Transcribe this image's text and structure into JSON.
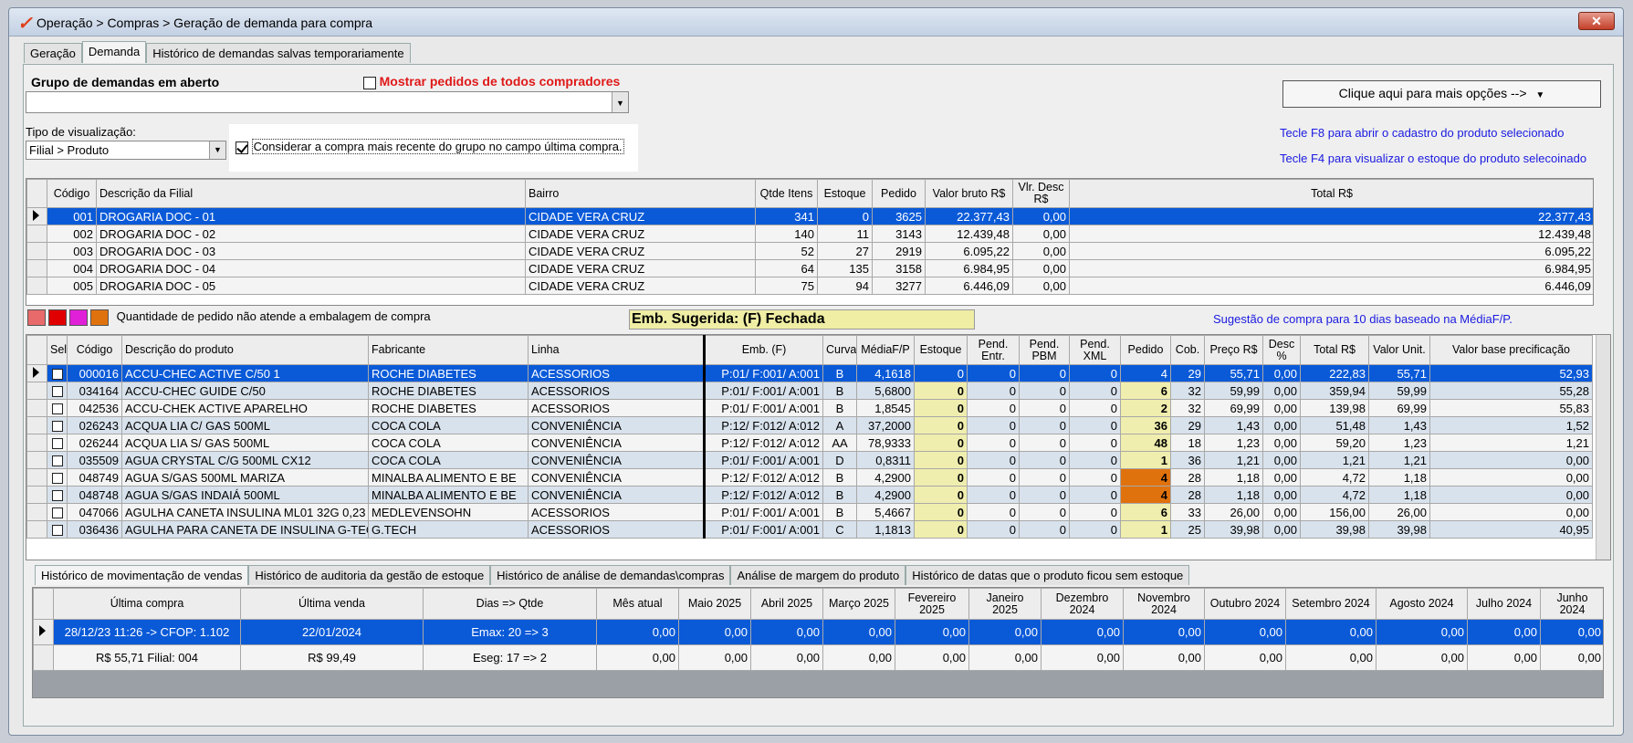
{
  "window": {
    "title": "Operação > Compras > Geração de demanda para compra",
    "close_label": "✕"
  },
  "tabs": [
    {
      "label": "Geração"
    },
    {
      "label": "Demanda"
    },
    {
      "label": "Histórico de demandas salvas temporariamente"
    }
  ],
  "top": {
    "group_label": "Grupo de demandas em aberto",
    "show_all_label": "Mostrar pedidos de todos compradores",
    "group_value": "",
    "view_type_label": "Tipo de visualização:",
    "view_type_value": "Filial > Produto",
    "consider_label": "Considerar a compra mais recente do grupo no campo última compra.",
    "options_button": "Clique aqui para mais opções -->",
    "hint_f8": "Tecle F8 para abrir o cadastro do produto selecionado",
    "hint_f4": "Tecle F4 para visualizar o estoque do produto selecoinado"
  },
  "branch_grid": {
    "headers": [
      "Código",
      "Descrição da Filial",
      "Bairro",
      "Qtde Itens",
      "Estoque",
      "Pedido",
      "Valor bruto R$",
      "Vlr. Desc R$",
      "Total R$"
    ],
    "rows": [
      [
        "001",
        "DROGARIA DOC - 01",
        "CIDADE VERA CRUZ",
        "341",
        "0",
        "3625",
        "22.377,43",
        "0,00",
        "22.377,43"
      ],
      [
        "002",
        "DROGARIA DOC - 02",
        "CIDADE VERA CRUZ",
        "140",
        "11",
        "3143",
        "12.439,48",
        "0,00",
        "12.439,48"
      ],
      [
        "003",
        "DROGARIA DOC - 03",
        "CIDADE VERA CRUZ",
        "52",
        "27",
        "2919",
        "6.095,22",
        "0,00",
        "6.095,22"
      ],
      [
        "004",
        "DROGARIA DOC - 04",
        "CIDADE VERA CRUZ",
        "64",
        "135",
        "3158",
        "6.984,95",
        "0,00",
        "6.984,95"
      ],
      [
        "005",
        "DROGARIA DOC - 05",
        "CIDADE VERA CRUZ",
        "75",
        "94",
        "3277",
        "6.446,09",
        "0,00",
        "6.446,09"
      ]
    ]
  },
  "legend": {
    "text": "Quantidade de pedido não atende a embalagem de compra",
    "colors": [
      "#e86a6a",
      "#e00000",
      "#e020d8",
      "#e0720e"
    ],
    "emb_label": "Emb. Sugerida: (F) Fechada",
    "suggestion": "Sugestão de compra para 10 dias baseado na MédiaF/P."
  },
  "product_grid": {
    "headers": [
      "Sel",
      "Código",
      "Descrição do produto",
      "Fabricante",
      "Linha",
      "Emb. (F)",
      "Curva",
      "MédiaF/P",
      "Estoque",
      "Pend. Entr.",
      "Pend. PBM",
      "Pend. XML",
      "Pedido",
      "Cob.",
      "Preço R$",
      "Desc %",
      "Total R$",
      "Valor Unit.",
      "Valor base precificação"
    ],
    "rows": [
      [
        "000016",
        "ACCU-CHEC ACTIVE C/50 1",
        "ROCHE DIABETES",
        "ACESSORIOS",
        "P:01/ F:001/ A:001",
        "B",
        "4,1618",
        "0",
        "0",
        "0",
        "0",
        "4",
        "29",
        "55,71",
        "0,00",
        "222,83",
        "55,71",
        "52,93"
      ],
      [
        "034164",
        "ACCU-CHEC GUIDE C/50",
        "ROCHE DIABETES",
        "ACESSORIOS",
        "P:01/ F:001/ A:001",
        "B",
        "5,6800",
        "0",
        "0",
        "0",
        "0",
        "6",
        "32",
        "59,99",
        "0,00",
        "359,94",
        "59,99",
        "55,28"
      ],
      [
        "042536",
        "ACCU-CHEK ACTIVE APARELHO",
        "ROCHE DIABETES",
        "ACESSORIOS",
        "P:01/ F:001/ A:001",
        "B",
        "1,8545",
        "0",
        "0",
        "0",
        "0",
        "2",
        "32",
        "69,99",
        "0,00",
        "139,98",
        "69,99",
        "55,83"
      ],
      [
        "026243",
        "ACQUA LIA C/ GAS 500ML",
        "COCA COLA",
        "CONVENIÊNCIA",
        "P:12/ F:012/ A:012",
        "A",
        "37,2000",
        "0",
        "0",
        "0",
        "0",
        "36",
        "29",
        "1,43",
        "0,00",
        "51,48",
        "1,43",
        "1,52"
      ],
      [
        "026244",
        "ACQUA LIA S/ GAS 500ML",
        "COCA COLA",
        "CONVENIÊNCIA",
        "P:12/ F:012/ A:012",
        "AA",
        "78,9333",
        "0",
        "0",
        "0",
        "0",
        "48",
        "18",
        "1,23",
        "0,00",
        "59,20",
        "1,23",
        "1,21"
      ],
      [
        "035509",
        "AGUA CRYSTAL C/G 500ML CX12",
        "COCA COLA",
        "CONVENIÊNCIA",
        "P:01/ F:001/ A:001",
        "D",
        "0,8311",
        "0",
        "0",
        "0",
        "0",
        "1",
        "36",
        "1,21",
        "0,00",
        "1,21",
        "1,21",
        "0,00"
      ],
      [
        "048749",
        "AGUA S/GAS 500ML MARIZA",
        "MINALBA ALIMENTO E BE",
        "CONVENIÊNCIA",
        "P:12/ F:012/ A:012",
        "B",
        "4,2900",
        "0",
        "0",
        "0",
        "0",
        "4",
        "28",
        "1,18",
        "0,00",
        "4,72",
        "1,18",
        "0,00"
      ],
      [
        "048748",
        "AGUA S/GAS INDAIÁ 500ML",
        "MINALBA ALIMENTO E BE",
        "CONVENIÊNCIA",
        "P:12/ F:012/ A:012",
        "B",
        "4,2900",
        "0",
        "0",
        "0",
        "0",
        "4",
        "28",
        "1,18",
        "0,00",
        "4,72",
        "1,18",
        "0,00"
      ],
      [
        "047066",
        "AGULHA CANETA INSULINA ML01 32G 0,23",
        "MEDLEVENSOHN",
        "ACESSORIOS",
        "P:01/ F:001/ A:001",
        "B",
        "5,4667",
        "0",
        "0",
        "0",
        "0",
        "6",
        "33",
        "26,00",
        "0,00",
        "156,00",
        "26,00",
        "0,00"
      ],
      [
        "036436",
        "AGULHA PARA CANETA DE INSULINA G-TECH",
        "G.TECH",
        "ACESSORIOS",
        "P:01/ F:001/ A:001",
        "C",
        "1,1813",
        "0",
        "0",
        "0",
        "0",
        "1",
        "25",
        "39,98",
        "0,00",
        "39,98",
        "39,98",
        "40,95"
      ]
    ]
  },
  "bottom_tabs": [
    {
      "label": "Histórico de movimentação de vendas"
    },
    {
      "label": "Histórico de auditoria da gestão de estoque"
    },
    {
      "label": "Histórico de análise de demandas\\compras"
    },
    {
      "label": "Análise de margem do produto"
    },
    {
      "label": "Histórico de datas que o produto ficou sem estoque"
    }
  ],
  "history_grid": {
    "headers": [
      "Última compra",
      "Última venda",
      "Dias => Qtde",
      "Mês atual",
      "Maio 2025",
      "Abril 2025",
      "Março 2025",
      "Fevereiro 2025",
      "Janeiro 2025",
      "Dezembro 2024",
      "Novembro 2024",
      "Outubro 2024",
      "Setembro 2024",
      "Agosto 2024",
      "Julho 2024",
      "Junho 2024"
    ],
    "rows": [
      [
        "28/12/23 11:26 -> CFOP: 1.102",
        "22/01/2024",
        "Emax: 20 => 3",
        "0,00",
        "0,00",
        "0,00",
        "0,00",
        "0,00",
        "0,00",
        "0,00",
        "0,00",
        "0,00",
        "0,00",
        "0,00",
        "0,00",
        "0,00"
      ],
      [
        "R$ 55,71 Filial: 004",
        "R$ 99,49",
        "Eseg: 17 => 2",
        "0,00",
        "0,00",
        "0,00",
        "0,00",
        "0,00",
        "0,00",
        "0,00",
        "0,00",
        "0,00",
        "0,00",
        "0,00",
        "0,00",
        "0,00"
      ]
    ]
  }
}
